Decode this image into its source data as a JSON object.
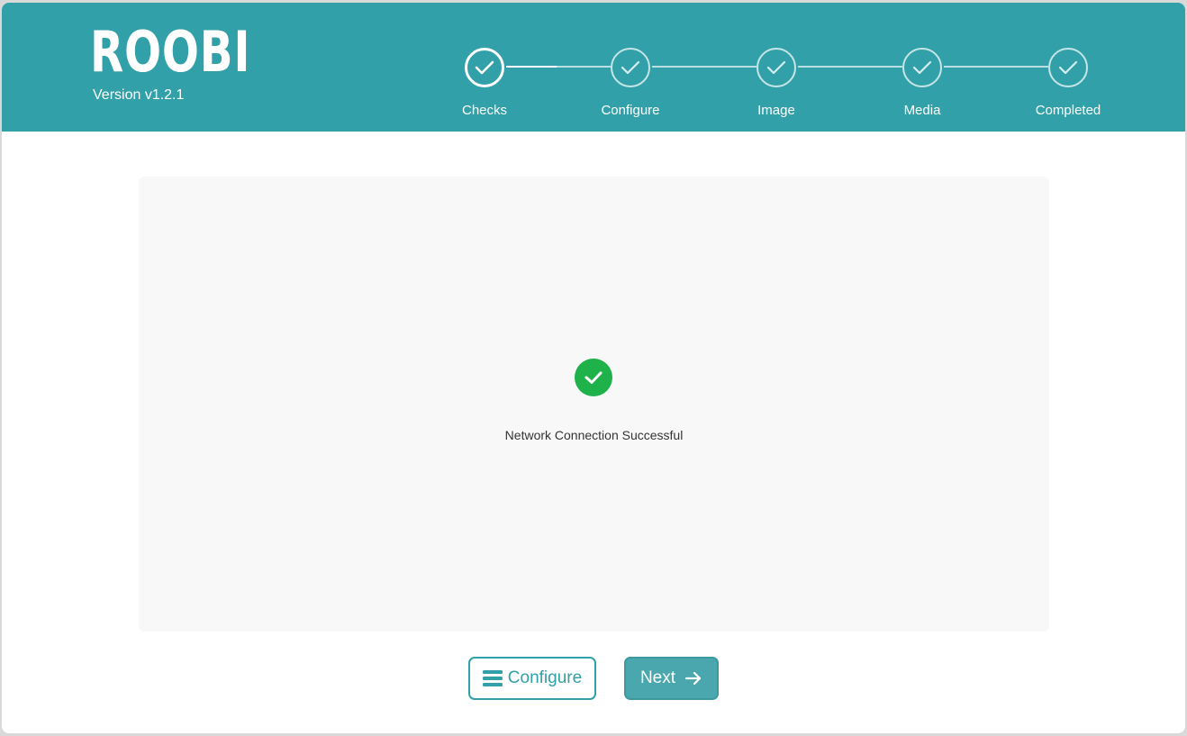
{
  "brand": {
    "title": "ROOBI",
    "version": "Version v1.2.1"
  },
  "steps": [
    {
      "label": "Checks",
      "state": "active"
    },
    {
      "label": "Configure",
      "state": "done"
    },
    {
      "label": "Image",
      "state": "done"
    },
    {
      "label": "Media",
      "state": "done"
    },
    {
      "label": "Completed",
      "state": "done"
    }
  ],
  "status": {
    "icon": "check-circle-icon",
    "message": "Network Connection Successful"
  },
  "actions": {
    "configure_label": "Configure",
    "next_label": "Next"
  },
  "colors": {
    "header": "#32a0a8",
    "success": "#1fb14a",
    "accent": "#32a0a8"
  }
}
